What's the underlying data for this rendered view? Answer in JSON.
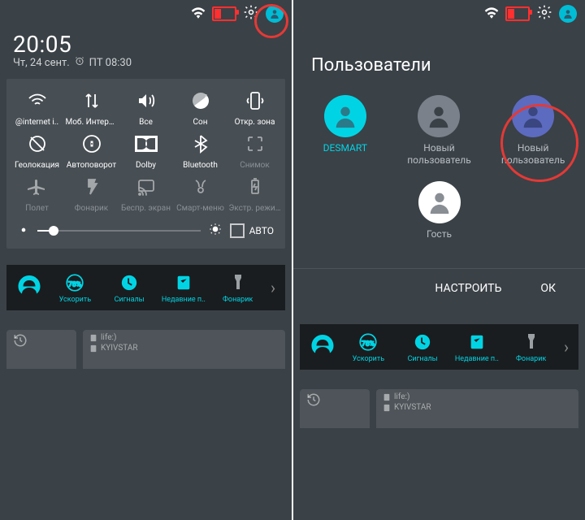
{
  "left": {
    "time": "20:05",
    "date_day": "Чт, 24 сент.",
    "alarm": "ПТ 08:30",
    "brightness_pct": 10,
    "brightness_auto_label": "АВТО",
    "qs": [
      {
        "icon": "wifi",
        "label": "@internet i..",
        "dim": false
      },
      {
        "icon": "data",
        "label": "Моб. Интернет",
        "dim": false
      },
      {
        "icon": "sound",
        "label": "Все",
        "dim": false
      },
      {
        "icon": "dnd",
        "label": "Сон",
        "dim": false
      },
      {
        "icon": "hotspot",
        "label": "Откр. зона",
        "dim": false
      },
      {
        "icon": "location",
        "label": "Геолокация",
        "dim": false
      },
      {
        "icon": "rotate",
        "label": "Автоповорот",
        "dim": false
      },
      {
        "icon": "dolby",
        "label": "Dolby",
        "dim": false
      },
      {
        "icon": "bluetooth",
        "label": "Bluetooth",
        "dim": false
      },
      {
        "icon": "screenshot",
        "label": "Снимок",
        "dim": true
      },
      {
        "icon": "airplane",
        "label": "Полет",
        "dim": true
      },
      {
        "icon": "flash",
        "label": "Фонарик",
        "dim": true
      },
      {
        "icon": "cast",
        "label": "Беспр. экран",
        "dim": true
      },
      {
        "icon": "smart",
        "label": "Смарт-меню",
        "dim": true
      },
      {
        "icon": "battery-saver",
        "label": "Экстр. режим",
        "dim": true
      }
    ],
    "dock": [
      {
        "icon": "boost",
        "label": "Ускорить"
      },
      {
        "icon": "signals",
        "label": "Сигналы"
      },
      {
        "icon": "recent",
        "label": "Недавние п.."
      },
      {
        "icon": "torch",
        "label": "Фонарик"
      }
    ],
    "cards": {
      "sim1": "life:)",
      "sim2": "KYIVSTAR"
    }
  },
  "right": {
    "title": "Пользователи",
    "users": [
      {
        "name": "DESMART",
        "kind": "active"
      },
      {
        "name": "Новый пользователь",
        "kind": "new"
      },
      {
        "name": "Новый пользователь",
        "kind": "purple"
      },
      {
        "name": "Гость",
        "kind": "guest"
      }
    ],
    "action_settings": "НАСТРОИТЬ",
    "action_ok": "ОК",
    "dock": [
      {
        "icon": "boost",
        "label": "Ускорить"
      },
      {
        "icon": "signals",
        "label": "Сигналы"
      },
      {
        "icon": "recent",
        "label": "Недавние п.."
      },
      {
        "icon": "torch",
        "label": "Фонарик"
      }
    ],
    "cards": {
      "sim1": "life:)",
      "sim2": "KYIVSTAR"
    }
  }
}
